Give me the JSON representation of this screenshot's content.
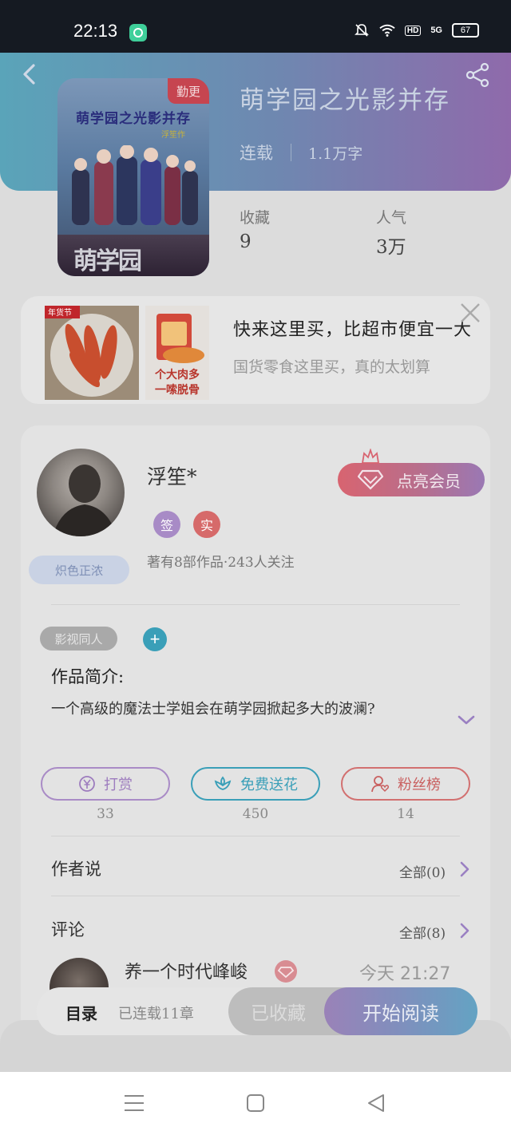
{
  "status_bar": {
    "time": "22:13",
    "network": "5G",
    "hd": "HD",
    "battery": "67"
  },
  "header": {
    "book_title": "萌学园之光影并存",
    "serial_status": "连载",
    "word_count": "1.1万字",
    "cover_badge": "勤更",
    "cover_title": "萌学园之光影并存",
    "cover_author": "浮笙作",
    "cover_bottom_text": "萌学园"
  },
  "stats": [
    {
      "label": "收藏",
      "value": "9"
    },
    {
      "label": "人气",
      "value": "3万"
    }
  ],
  "ad": {
    "title": "快来这里买，比超市便宜一大",
    "subtitle": "国货零食这里买，真的太划算",
    "img_tag": "年货节",
    "img_caption_1": "个大肉多",
    "img_caption_2": "一嗦脱骨"
  },
  "author": {
    "name": "浮笙*",
    "badge": "炽色正浓",
    "tags": [
      "签",
      "实"
    ],
    "meta": "著有8部作品·243人关注",
    "vip_label": "点亮会员"
  },
  "work": {
    "genre": "影视同人",
    "intro_label": "作品简介:",
    "intro_text": "一个高级的魔法士学姐会在萌学园掀起多大的波澜?"
  },
  "actions": [
    {
      "label": "打赏",
      "count": "33",
      "color": "#a07cc0"
    },
    {
      "label": "免费送花",
      "count": "450",
      "color": "#3a9fb8"
    },
    {
      "label": "粉丝榜",
      "count": "14",
      "color": "#c96060"
    }
  ],
  "sections": {
    "author_say": {
      "title": "作者说",
      "more": "全部(0)"
    },
    "comments": {
      "title": "评论",
      "more": "全部(8)"
    }
  },
  "comment": {
    "user": "养一个时代峰峻",
    "time": "今天 21:27"
  },
  "read_bar": {
    "toc_label": "目录",
    "toc_sub": "已连载11章",
    "collected_label": "已收藏",
    "read_label": "开始阅读"
  }
}
